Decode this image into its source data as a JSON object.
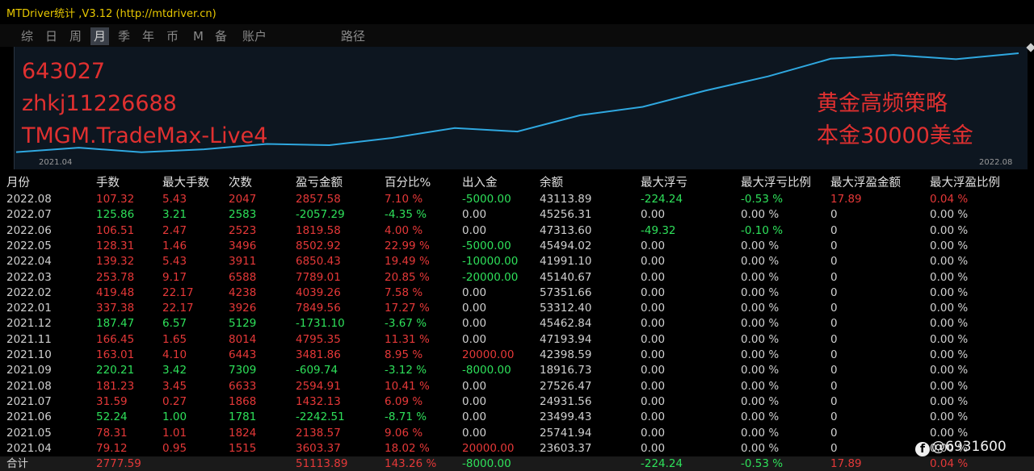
{
  "window": {
    "title": "MTDriver统计 ,V3.12 (http://mtdriver.cn)"
  },
  "tabs": [
    {
      "label": "综",
      "active": false
    },
    {
      "label": "日",
      "active": false
    },
    {
      "label": "周",
      "active": false
    },
    {
      "label": "月",
      "active": true
    },
    {
      "label": "季",
      "active": false
    },
    {
      "label": "年",
      "active": false
    },
    {
      "label": "币",
      "active": false
    },
    {
      "label": "M",
      "active": false
    },
    {
      "label": "备",
      "active": false
    },
    {
      "label": "账户",
      "active": false
    },
    {
      "label": "路径",
      "active": false
    }
  ],
  "chart": {
    "overlay_left": [
      "643027",
      "zhkj11226688",
      "TMGM.TradeMax-Live4"
    ],
    "overlay_right": [
      "黄金高频策略",
      "本金30000美金"
    ],
    "date_start": "2021.04",
    "date_end": "2022.08",
    "line_color": "#2fa8e0",
    "overlay_color": "#e03030"
  },
  "chart_data": {
    "type": "line",
    "x": [
      "2021.04",
      "2021.05",
      "2021.06",
      "2021.07",
      "2021.08",
      "2021.09",
      "2021.10",
      "2021.11",
      "2021.12",
      "2022.01",
      "2022.02",
      "2022.03",
      "2022.04",
      "2022.05",
      "2022.06",
      "2022.07",
      "2022.08"
    ],
    "series": [
      {
        "values": [
          3603.37,
          5741.94,
          3499.43,
          4931.56,
          7526.47,
          6916.73,
          10398.59,
          15193.94,
          13462.84,
          21312.4,
          25351.66,
          33140.67,
          39991.18,
          48494.02,
          50313.6,
          48256.31,
          51113.89
        ]
      }
    ],
    "xlabel": "",
    "ylabel": "",
    "grid": false
  },
  "table": {
    "headers": [
      "月份",
      "手数",
      "最大手数",
      "次数",
      "盈亏金额",
      "百分比%",
      "出入金",
      "余额",
      "最大浮亏",
      "最大浮亏比例",
      "最大浮盈金额",
      "最大浮盈比例"
    ],
    "rows": [
      [
        "2022.08",
        "107.32",
        "5.43",
        "2047",
        "2857.58",
        "7.10 %",
        "-5000.00",
        "43113.89",
        "-224.24",
        "-0.53 %",
        "17.89",
        "0.04 %"
      ],
      [
        "2022.07",
        "125.86",
        "3.21",
        "2583",
        "-2057.29",
        "-4.35 %",
        "0.00",
        "45256.31",
        "0.00",
        "0.00 %",
        "0",
        "0.00 %"
      ],
      [
        "2022.06",
        "106.51",
        "2.47",
        "2523",
        "1819.58",
        "4.00 %",
        "0.00",
        "47313.60",
        "-49.32",
        "-0.10 %",
        "0",
        "0.00 %"
      ],
      [
        "2022.05",
        "128.31",
        "1.46",
        "3496",
        "8502.92",
        "22.99 %",
        "-5000.00",
        "45494.02",
        "0.00",
        "0.00 %",
        "0",
        "0.00 %"
      ],
      [
        "2022.04",
        "139.32",
        "5.43",
        "3911",
        "6850.43",
        "19.49 %",
        "-10000.00",
        "41991.10",
        "0.00",
        "0.00 %",
        "0",
        "0.00 %"
      ],
      [
        "2022.03",
        "253.78",
        "9.17",
        "6588",
        "7789.01",
        "20.85 %",
        "-20000.00",
        "45140.67",
        "0.00",
        "0.00 %",
        "0",
        "0.00 %"
      ],
      [
        "2022.02",
        "419.48",
        "22.17",
        "4238",
        "4039.26",
        "7.58 %",
        "0.00",
        "57351.66",
        "0.00",
        "0.00 %",
        "0",
        "0.00 %"
      ],
      [
        "2022.01",
        "337.38",
        "22.17",
        "3926",
        "7849.56",
        "17.27 %",
        "0.00",
        "53312.40",
        "0.00",
        "0.00 %",
        "0",
        "0.00 %"
      ],
      [
        "2021.12",
        "187.47",
        "6.57",
        "5129",
        "-1731.10",
        "-3.67 %",
        "0.00",
        "45462.84",
        "0.00",
        "0.00 %",
        "0",
        "0.00 %"
      ],
      [
        "2021.11",
        "166.45",
        "1.65",
        "8014",
        "4795.35",
        "11.31 %",
        "0.00",
        "47193.94",
        "0.00",
        "0.00 %",
        "0",
        "0.00 %"
      ],
      [
        "2021.10",
        "163.01",
        "4.10",
        "6443",
        "3481.86",
        "8.95 %",
        "20000.00",
        "42398.59",
        "0.00",
        "0.00 %",
        "0",
        "0.00 %"
      ],
      [
        "2021.09",
        "220.21",
        "3.42",
        "7309",
        "-609.74",
        "-3.12 %",
        "-8000.00",
        "18916.73",
        "0.00",
        "0.00 %",
        "0",
        "0.00 %"
      ],
      [
        "2021.08",
        "181.23",
        "3.45",
        "6633",
        "2594.91",
        "10.41 %",
        "0.00",
        "27526.47",
        "0.00",
        "0.00 %",
        "0",
        "0.00 %"
      ],
      [
        "2021.07",
        "31.59",
        "0.27",
        "1868",
        "1432.13",
        "6.09 %",
        "0.00",
        "24931.56",
        "0.00",
        "0.00 %",
        "0",
        "0.00 %"
      ],
      [
        "2021.06",
        "52.24",
        "1.00",
        "1781",
        "-2242.51",
        "-8.71 %",
        "0.00",
        "23499.43",
        "0.00",
        "0.00 %",
        "0",
        "0.00 %"
      ],
      [
        "2021.05",
        "78.31",
        "1.01",
        "1824",
        "2138.57",
        "9.06 %",
        "0.00",
        "25741.94",
        "0.00",
        "0.00 %",
        "0",
        "0.00 %"
      ],
      [
        "2021.04",
        "79.12",
        "0.95",
        "1515",
        "3603.37",
        "18.02 %",
        "20000.00",
        "23603.37",
        "0.00",
        "0.00 %",
        "0",
        "0.00 %"
      ]
    ],
    "total": [
      "合计",
      "2777.59",
      "",
      "",
      "51113.89",
      "143.26 %",
      "-8000.00",
      "",
      "-224.24",
      "-0.53 %",
      "17.89",
      "0.04 %"
    ]
  },
  "colors": {
    "positive": "#e53838",
    "negative": "#2ee05a",
    "neutral": "#d0d0d0",
    "title": "#e8c800"
  },
  "watermark": {
    "icon": "facebook-icon",
    "text": "@6931600"
  }
}
